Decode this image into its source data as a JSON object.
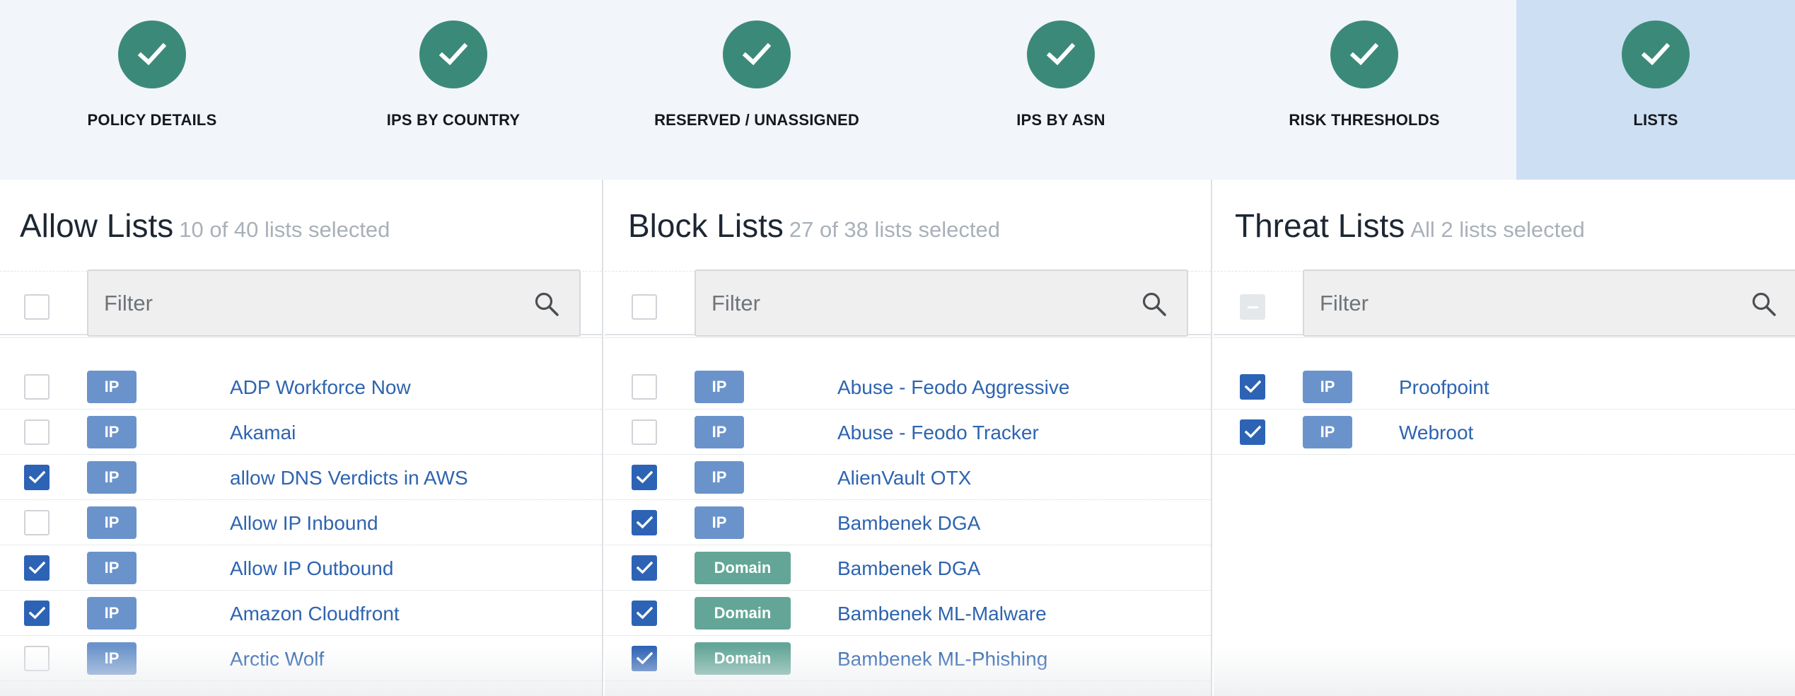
{
  "steps": [
    {
      "label": "POLICY DETAILS",
      "status": "complete"
    },
    {
      "label": "IPS BY COUNTRY",
      "status": "complete"
    },
    {
      "label": "RESERVED / UNASSIGNED",
      "status": "complete"
    },
    {
      "label": "IPS BY ASN",
      "status": "complete"
    },
    {
      "label": "RISK THRESHOLDS",
      "status": "complete"
    },
    {
      "label": "LISTS",
      "status": "complete",
      "active": true
    }
  ],
  "panels": {
    "allow": {
      "title": "Allow Lists",
      "subtitle": "10 of 40 lists selected",
      "filter_placeholder": "Filter",
      "select_all_state": "unchecked",
      "items": [
        {
          "tag": "IP",
          "name": "ADP Workforce Now",
          "checked": false
        },
        {
          "tag": "IP",
          "name": "Akamai",
          "checked": false
        },
        {
          "tag": "IP",
          "name": "allow DNS Verdicts in AWS",
          "checked": true
        },
        {
          "tag": "IP",
          "name": "Allow IP Inbound",
          "checked": false
        },
        {
          "tag": "IP",
          "name": "Allow IP Outbound",
          "checked": true
        },
        {
          "tag": "IP",
          "name": "Amazon Cloudfront",
          "checked": true
        },
        {
          "tag": "IP",
          "name": "Arctic Wolf",
          "checked": false
        }
      ]
    },
    "block": {
      "title": "Block Lists",
      "subtitle": "27 of 38 lists selected",
      "filter_placeholder": "Filter",
      "select_all_state": "unchecked",
      "items": [
        {
          "tag": "IP",
          "name": "Abuse - Feodo Aggressive",
          "checked": false
        },
        {
          "tag": "IP",
          "name": "Abuse - Feodo Tracker",
          "checked": false
        },
        {
          "tag": "IP",
          "name": "AlienVault OTX",
          "checked": true
        },
        {
          "tag": "IP",
          "name": "Bambenek DGA",
          "checked": true
        },
        {
          "tag": "Domain",
          "name": "Bambenek DGA",
          "checked": true
        },
        {
          "tag": "Domain",
          "name": "Bambenek ML-Malware",
          "checked": true
        },
        {
          "tag": "Domain",
          "name": "Bambenek ML-Phishing",
          "checked": true
        }
      ]
    },
    "threat": {
      "title": "Threat Lists",
      "subtitle": "All 2 lists selected",
      "filter_placeholder": "Filter",
      "select_all_state": "indeterminate",
      "items": [
        {
          "tag": "IP",
          "name": "Proofpoint",
          "checked": true
        },
        {
          "tag": "IP",
          "name": "Webroot",
          "checked": true
        }
      ]
    }
  },
  "icons": {
    "step_complete": "checkmark-icon",
    "filter": "search-icon"
  },
  "colors": {
    "step_complete": "#3b8a79",
    "step_active_bg": "#cddff3",
    "checkbox_checked": "#2d63b5",
    "tag_ip": "#6b93cb",
    "tag_domain": "#63a697",
    "link": "#2e64b0"
  }
}
